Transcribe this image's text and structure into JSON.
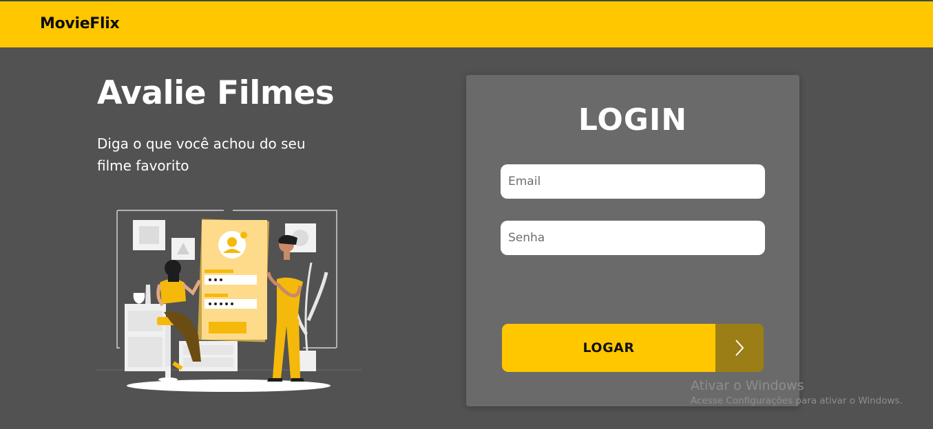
{
  "colors": {
    "brand": "#FFC700",
    "background": "#525252",
    "card": "#6a6a6a",
    "button_arrow": "#9c7e16"
  },
  "navbar": {
    "brand": "MovieFlix"
  },
  "hero": {
    "title": "Avalie Filmes",
    "subtitle": "Diga o que você achou do seu filme favorito",
    "illustration_icon": "people-login-illustration"
  },
  "login": {
    "title": "LOGIN",
    "email_placeholder": "Email",
    "password_placeholder": "Senha",
    "submit_label": "LOGAR",
    "submit_icon": "chevron-right-icon"
  },
  "watermark": {
    "line1": "Ativar o Windows",
    "line2": "Acesse Configurações para ativar o Windows."
  }
}
